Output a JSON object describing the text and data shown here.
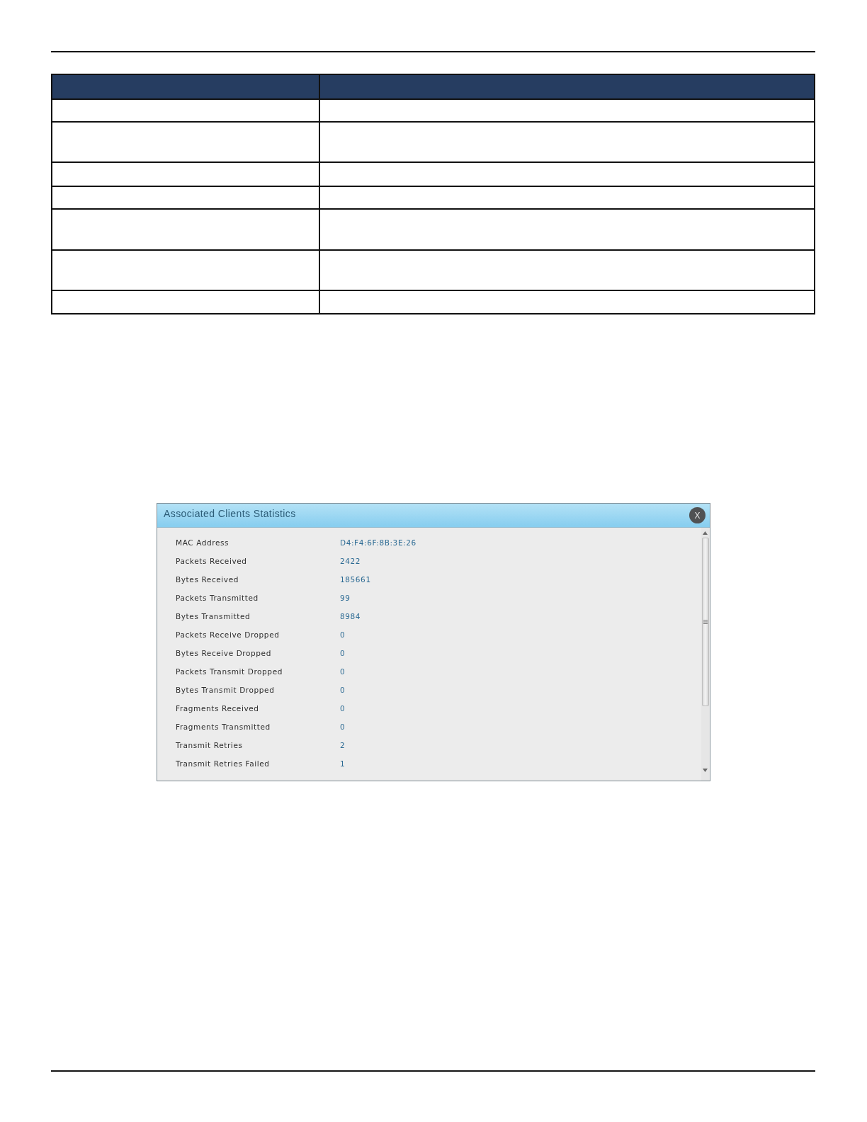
{
  "dialog": {
    "title": "Associated Clients Statistics",
    "close_label": "X",
    "rows": [
      {
        "label": "MAC Address",
        "value": "D4:F4:6F:8B:3E:26"
      },
      {
        "label": "Packets Received",
        "value": "2422"
      },
      {
        "label": "Bytes Received",
        "value": "185661"
      },
      {
        "label": "Packets Transmitted",
        "value": "99"
      },
      {
        "label": "Bytes Transmitted",
        "value": "8984"
      },
      {
        "label": "Packets Receive Dropped",
        "value": "0"
      },
      {
        "label": "Bytes Receive Dropped",
        "value": "0"
      },
      {
        "label": "Packets Transmit Dropped",
        "value": "0"
      },
      {
        "label": "Bytes Transmit Dropped",
        "value": "0"
      },
      {
        "label": "Fragments Received",
        "value": "0"
      },
      {
        "label": "Fragments Transmitted",
        "value": "0"
      },
      {
        "label": "Transmit Retries",
        "value": "2"
      },
      {
        "label": "Transmit Retries Failed",
        "value": "1"
      }
    ]
  }
}
